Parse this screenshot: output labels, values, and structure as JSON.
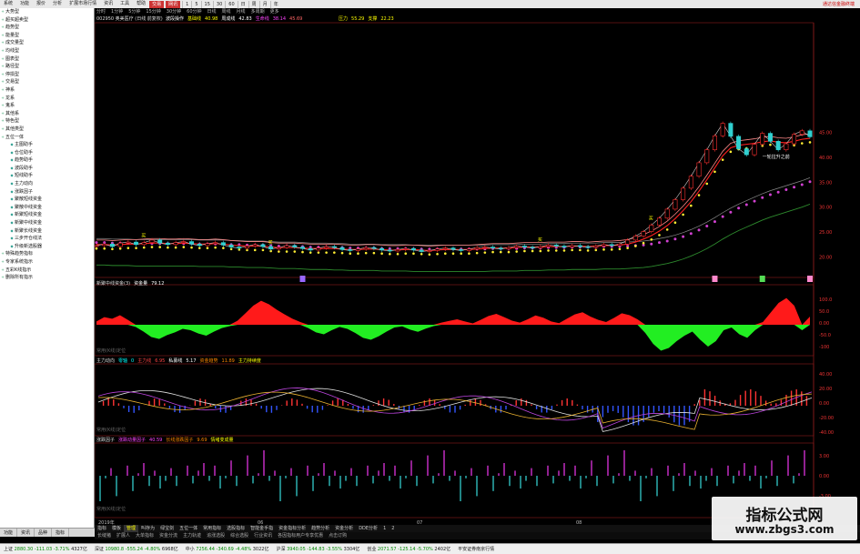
{
  "menubar": {
    "items": [
      "系统",
      "功能",
      "报价",
      "分析",
      "扩展市场行情",
      "资讯",
      "工具",
      "帮助"
    ],
    "tabs": [
      "交易",
      "网讯"
    ],
    "periods": [
      "1",
      "5",
      "15",
      "30",
      "60",
      "日",
      "周",
      "月",
      "年"
    ],
    "brand": "通达信金融终端"
  },
  "sidebar": {
    "items": [
      {
        "label": "大势型",
        "child": false
      },
      {
        "label": "超买超卖型",
        "child": false
      },
      {
        "label": "趋势型",
        "child": false
      },
      {
        "label": "能量型",
        "child": false
      },
      {
        "label": "成交量型",
        "child": false
      },
      {
        "label": "均线型",
        "child": false
      },
      {
        "label": "图表型",
        "child": false
      },
      {
        "label": "路径型",
        "child": false
      },
      {
        "label": "停损型",
        "child": false
      },
      {
        "label": "交易型",
        "child": false
      },
      {
        "label": "神系",
        "child": false
      },
      {
        "label": "龙系",
        "child": false
      },
      {
        "label": "鬼系",
        "child": false
      },
      {
        "label": "其他系",
        "child": false
      },
      {
        "label": "特色型",
        "child": false
      },
      {
        "label": "其他类型",
        "child": false
      },
      {
        "label": "五位一体",
        "child": false
      },
      {
        "label": "主图助手",
        "child": true
      },
      {
        "label": "仓位助手",
        "child": true
      },
      {
        "label": "趋势助手",
        "child": true
      },
      {
        "label": "波段助手",
        "child": true
      },
      {
        "label": "短线助手",
        "child": true
      },
      {
        "label": "主力动向",
        "child": true
      },
      {
        "label": "涨跌因子",
        "child": true
      },
      {
        "label": "聚散短线资金",
        "child": true
      },
      {
        "label": "聚散中线资金",
        "child": true
      },
      {
        "label": "新聚短线资金",
        "child": true
      },
      {
        "label": "新聚中线资金",
        "child": true
      },
      {
        "label": "新聚长线资金",
        "child": true
      },
      {
        "label": "三步开仓线法",
        "child": true
      },
      {
        "label": "升级新选股器",
        "child": true
      },
      {
        "label": "特殊趋势指标",
        "child": false
      },
      {
        "label": "专家系统指示",
        "child": false
      },
      {
        "label": "五彩K线指示",
        "child": false
      },
      {
        "label": "删除所有指示",
        "child": false
      }
    ]
  },
  "chart": {
    "period_tabs": [
      "分时",
      "1分钟",
      "5分钟",
      "15分钟",
      "30分钟",
      "60分钟",
      "日线",
      "周线",
      "月线",
      "多周期",
      "更多"
    ],
    "title": "002950 奥美医疗 (日线 前复权)",
    "main_indicator": {
      "name": "波段操作",
      "label1": "基础线",
      "value1": "40.98",
      "label2": "周成线",
      "value2": "42.83",
      "label3": "生命线",
      "value3": "38.14",
      "value4": "45.69"
    },
    "pressure": {
      "label": "压力",
      "value": "55.29",
      "support_label": "支撑",
      "support_value": "22.23"
    },
    "price_axis": [
      "45.00",
      "40.00",
      "35.00",
      "30.00",
      "25.00",
      "20.00"
    ],
    "pane2": {
      "title": "新聚中线资金(3)",
      "label": "资金量",
      "value": "79.12",
      "axis": [
        "100.0",
        "50.0",
        "0.00",
        "-50.0",
        "-100"
      ]
    },
    "pane3": {
      "title": "主力动向",
      "l1": "零轴",
      "v1": "0",
      "l2": "主力线",
      "v2": "6.95",
      "l3": "私募线",
      "v3": "5.17",
      "l4": "资金趋势",
      "v4": "11.89",
      "l5": "主力持续度",
      "v5": "",
      "axis": [
        "40.00",
        "20.00",
        "0.00",
        "-20.00",
        "-40.00"
      ]
    },
    "pane4": {
      "title": "涨跌因子",
      "l1": "涨跌动量因子",
      "v1": "40.59",
      "l2": "长线涨跌因子",
      "v2": "9.69",
      "l3": "情绪变成量",
      "v3": "",
      "axis": [
        "3.00",
        "0.00",
        "-3.00"
      ]
    },
    "pane_footer": "常用(K线)定位",
    "date_labels": [
      "2019年",
      "06",
      "07",
      "08"
    ],
    "annotations": {
      "buy": "买",
      "sell": "卖",
      "caption": "一轮拉升之前"
    }
  },
  "chart_data": {
    "type": "line",
    "title": "002950 奥美医疗 (日线 前复权)",
    "price_range": [
      17,
      48
    ],
    "closes": [
      22.3,
      22.6,
      22.1,
      22.8,
      23.0,
      22.5,
      22.9,
      23.4,
      22.8,
      22.5,
      22.9,
      23.1,
      22.6,
      22.3,
      22.7,
      22.9,
      22.4,
      22.0,
      21.8,
      22.2,
      22.5,
      22.1,
      21.6,
      21.9,
      22.3,
      22.0,
      21.7,
      21.4,
      21.8,
      22.1,
      21.9,
      21.5,
      21.3,
      21.6,
      21.9,
      21.7,
      21.4,
      21.2,
      21.5,
      21.7,
      21.4,
      21.1,
      21.3,
      21.6,
      21.8,
      21.5,
      21.3,
      21.6,
      21.9,
      22.0,
      21.8,
      21.6,
      21.9,
      22.2,
      22.0,
      21.8,
      22.1,
      22.4,
      22.2,
      22.0,
      22.3,
      22.1,
      21.9,
      22.2,
      22.5,
      22.3,
      22.6,
      23.4,
      24.2,
      25.1,
      26.4,
      27.8,
      29.6,
      31.5,
      33.8,
      36.2,
      38.9,
      41.5,
      44.3,
      46.8,
      44.2,
      41.7,
      40.5,
      42.6,
      44.8,
      43.2,
      41.5,
      42.7,
      44.6,
      45.3,
      44.1
    ],
    "ma_short": [
      22.5,
      22.5,
      22.4,
      22.5,
      22.6,
      22.6,
      22.7,
      22.8,
      22.8,
      22.7,
      22.7,
      22.8,
      22.7,
      22.6,
      22.6,
      22.7,
      22.6,
      22.4,
      22.3,
      22.2,
      22.2,
      22.2,
      22.0,
      21.9,
      21.9,
      21.9,
      21.8,
      21.7,
      21.7,
      21.7,
      21.7,
      21.6,
      21.5,
      21.5,
      21.6,
      21.6,
      21.5,
      21.4,
      21.4,
      21.5,
      21.5,
      21.4,
      21.3,
      21.4,
      21.5,
      21.5,
      21.5,
      21.5,
      21.6,
      21.7,
      21.8,
      21.8,
      21.8,
      21.9,
      22.0,
      22.0,
      22.0,
      22.1,
      22.1,
      22.1,
      22.2,
      22.2,
      22.1,
      22.2,
      22.3,
      22.3,
      22.4,
      22.6,
      23.0,
      23.6,
      24.3,
      25.2,
      26.3,
      27.7,
      29.3,
      31.1,
      33.2,
      35.5,
      37.9,
      40.3,
      41.9,
      42.4,
      42.6,
      42.8,
      43.1,
      43.3,
      43.0,
      42.9,
      43.2,
      43.6,
      43.8
    ],
    "ma_long": [
      22.9,
      22.9,
      22.8,
      22.8,
      22.8,
      22.7,
      22.7,
      22.7,
      22.7,
      22.7,
      22.7,
      22.7,
      22.7,
      22.6,
      22.6,
      22.6,
      22.6,
      22.5,
      22.5,
      22.4,
      22.4,
      22.4,
      22.3,
      22.2,
      22.2,
      22.2,
      22.1,
      22.0,
      22.0,
      22.0,
      21.9,
      21.9,
      21.8,
      21.8,
      21.8,
      21.8,
      21.7,
      21.7,
      21.7,
      21.7,
      21.6,
      21.6,
      21.6,
      21.6,
      21.6,
      21.6,
      21.6,
      21.6,
      21.6,
      21.6,
      21.7,
      21.7,
      21.7,
      21.7,
      21.8,
      21.8,
      21.8,
      21.9,
      21.9,
      21.9,
      22.0,
      22.0,
      22.0,
      22.0,
      22.1,
      22.1,
      22.1,
      22.2,
      22.3,
      22.4,
      22.6,
      22.9,
      23.2,
      23.6,
      24.1,
      24.7,
      25.4,
      26.2,
      27.1,
      28.1,
      29.0,
      29.8,
      30.5,
      31.2,
      31.9,
      32.5,
      33.0,
      33.5,
      34.0,
      34.5,
      35.1
    ],
    "fund_flow": [
      12,
      28,
      22,
      35,
      18,
      -8,
      -25,
      -45,
      -52,
      -38,
      -28,
      -15,
      -20,
      -32,
      -40,
      -25,
      -12,
      -5,
      15,
      42,
      70,
      88,
      75,
      55,
      38,
      22,
      10,
      -12,
      -28,
      -35,
      -20,
      -8,
      -15,
      -30,
      -48,
      -55,
      -42,
      -25,
      -10,
      -6,
      -18,
      -26,
      -14,
      -5,
      8,
      14,
      20,
      12,
      5,
      18,
      32,
      40,
      28,
      15,
      8,
      20,
      34,
      26,
      12,
      6,
      22,
      38,
      46,
      30,
      18,
      10,
      25,
      42,
      35,
      20,
      -30,
      -70,
      -95,
      -85,
      -60,
      -40,
      -25,
      -55,
      -80,
      -60,
      -20,
      -10,
      -35,
      -48,
      -20,
      10,
      45,
      80,
      98,
      70,
      -20,
      30
    ]
  },
  "bottom_tabs": [
    "功能",
    "资讯",
    "品种",
    "指标"
  ],
  "indicator_tabs": [
    "指标",
    "模板",
    "管理",
    "叫存为",
    "绿宝剑",
    "五位一体",
    "常用指标",
    "选股指标",
    "智能金手指",
    "资金指标分析",
    "趋势分析",
    "资金分析",
    "DDE分析",
    "1",
    "2"
  ],
  "indicator_tabs2": [
    "长缝猪",
    "扩展人",
    "大单指标",
    "资金分流",
    "主力轨迹",
    "追涨选股",
    "综合选股",
    "行业资讯",
    "各因指标用户专享优惠",
    "点击订购"
  ],
  "statusbar": [
    {
      "name": "上证",
      "value": "2880.30",
      "change": "-111.03",
      "pct": "-3.71%",
      "vol": "4327亿"
    },
    {
      "name": "深证",
      "value": "10980.8",
      "change": "-555.24",
      "pct": "-4.80%",
      "vol": "6968亿"
    },
    {
      "name": "中小",
      "value": "7256.44",
      "change": "-340.69",
      "pct": "-4.48%",
      "vol": "3022亿"
    },
    {
      "name": "沪深",
      "value": "3940.05",
      "change": "-144.83",
      "pct": "-3.55%",
      "vol": "3304亿"
    },
    {
      "name": "创业",
      "value": "2071.57",
      "change": "-125.14",
      "pct": "-5.70%",
      "vol": "2402亿"
    },
    {
      "name": "平安证券南京行情",
      "value": "",
      "change": "",
      "pct": "",
      "vol": ""
    }
  ],
  "watermark": {
    "line1": "指标公式网",
    "line2": "www.zbgs3.com"
  }
}
